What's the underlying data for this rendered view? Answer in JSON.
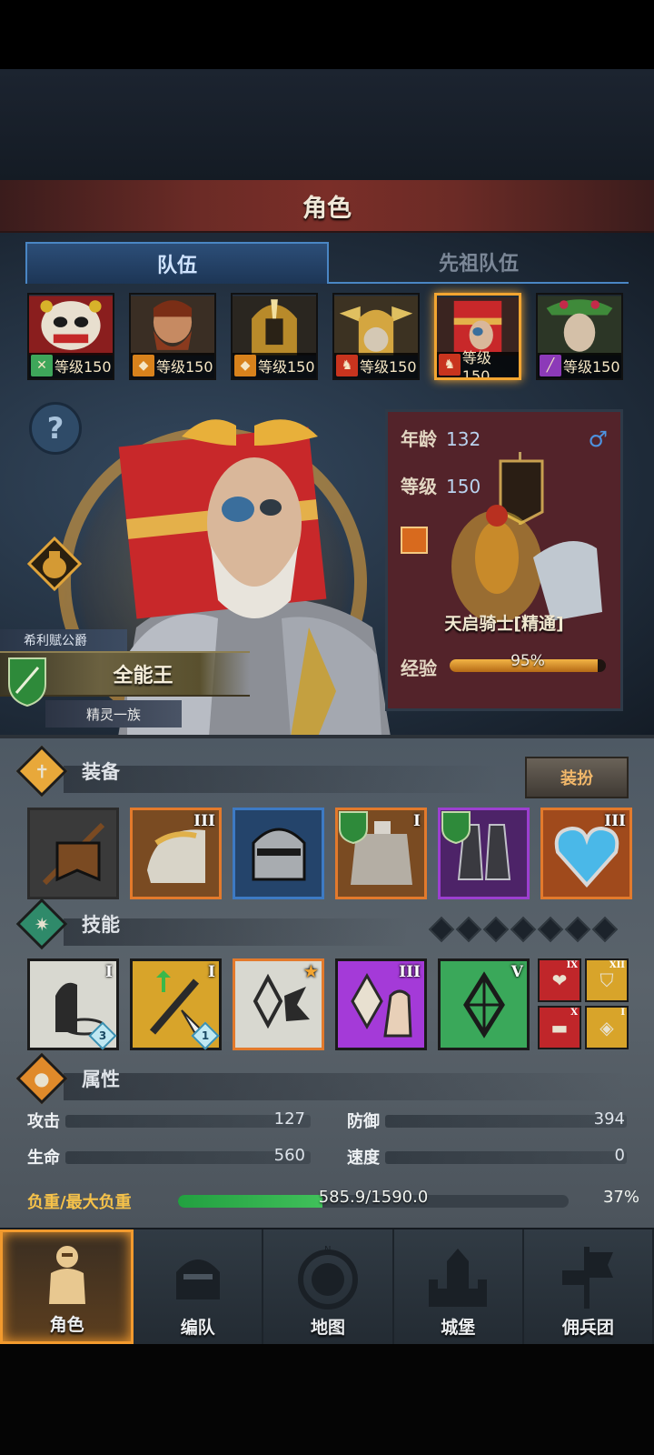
{
  "title": "角色",
  "tabs": [
    {
      "label": "队伍",
      "active": true
    },
    {
      "label": "先祖队伍",
      "active": false
    }
  ],
  "heroes": [
    {
      "level_label": "等级150",
      "class_color": "#3ea65a",
      "face": "lion-dancer",
      "selected": false
    },
    {
      "level_label": "等级150",
      "class_color": "#d8821c",
      "face": "bearded-warrior",
      "selected": false
    },
    {
      "level_label": "等级150",
      "class_color": "#d8821c",
      "face": "golden-helm",
      "selected": false
    },
    {
      "level_label": "等级150",
      "class_color": "#c8341e",
      "face": "winged-helm",
      "selected": false
    },
    {
      "level_label": "等级150",
      "class_color": "#c8341e",
      "face": "gift-box-knight",
      "selected": true
    },
    {
      "level_label": "等级150",
      "class_color": "#8c3ab8",
      "face": "elf-queen",
      "selected": false
    }
  ],
  "character": {
    "noble_title": "希利赋公爵",
    "name": "全能王",
    "race": "精灵一族"
  },
  "info": {
    "age_label": "年龄",
    "age_value": "132",
    "level_label": "等级",
    "level_value": "150",
    "gender": "male",
    "class_name": "天启骑士[精通]",
    "exp_label": "经验",
    "exp_text": "95%",
    "exp_fraction": 0.95
  },
  "equipment": {
    "title": "装备",
    "dress_button": "装扮",
    "slots": [
      {
        "item": "banner",
        "rank": "",
        "frame": "#2b2b2b",
        "bg": "#3f3f3f",
        "badge": false
      },
      {
        "item": "golden-pauldron",
        "rank": "III",
        "frame": "#e37a2c",
        "bg": "#7a4b22",
        "badge": false
      },
      {
        "item": "great-helm",
        "rank": "",
        "frame": "#3d7ac4",
        "bg": "#24446b",
        "badge": false
      },
      {
        "item": "silver-armor",
        "rank": "I",
        "frame": "#e37a2c",
        "bg": "#7a4b22",
        "badge": true
      },
      {
        "item": "plate-boots",
        "rank": "",
        "frame": "#9c3fd0",
        "bg": "#4d2368",
        "badge": true
      },
      {
        "item": "heart-amulet",
        "rank": "III",
        "frame": "#e37a2c",
        "bg": "#a04a1c",
        "badge": false
      }
    ]
  },
  "skills": {
    "title": "技能",
    "slots": [
      {
        "item": "summon-skill",
        "rank": "I",
        "frame": "#1c1c1c",
        "bg": "#d8d8d0",
        "gem": "3"
      },
      {
        "item": "sword-up-skill",
        "rank": "I",
        "frame": "#1c1c1c",
        "bg": "#d8a42a",
        "gem": "1"
      },
      {
        "item": "crystal-skill",
        "rank": "",
        "frame": "#e37a2c",
        "bg": "#d8d8d0",
        "star": true
      },
      {
        "item": "crystal-hand-skill",
        "rank": "III",
        "frame": "#1c1c1c",
        "bg": "#a43ad8",
        "gem": ""
      },
      {
        "item": "crystal-green-skill",
        "rank": "V",
        "frame": "#1c1c1c",
        "bg": "#3aa85a",
        "gem": ""
      }
    ],
    "passives": [
      {
        "icon": "heart",
        "rank": "IX",
        "bg": "#c0262a"
      },
      {
        "icon": "shield",
        "rank": "XII",
        "bg": "#d8a42a"
      },
      {
        "icon": "dumbbell",
        "rank": "X",
        "bg": "#c0262a"
      },
      {
        "icon": "shield-break",
        "rank": "I",
        "bg": "#d8a42a"
      }
    ]
  },
  "attributes": {
    "title": "属性",
    "attack_label": "攻击",
    "attack_value": "127",
    "defense_label": "防御",
    "defense_value": "394",
    "hp_label": "生命",
    "hp_value": "560",
    "speed_label": "速度",
    "speed_value": "0",
    "weight_label": "负重/最大负重",
    "weight_text": "585.9/1590.0",
    "weight_pct": "37%",
    "weight_fraction": 0.37
  },
  "nav": [
    {
      "label": "角色",
      "icon": "knight-icon",
      "active": true
    },
    {
      "label": "编队",
      "icon": "helmet-icon",
      "active": false
    },
    {
      "label": "地图",
      "icon": "compass-icon",
      "active": false
    },
    {
      "label": "城堡",
      "icon": "castle-icon",
      "active": false
    },
    {
      "label": "佣兵团",
      "icon": "banner-icon",
      "active": false
    }
  ]
}
